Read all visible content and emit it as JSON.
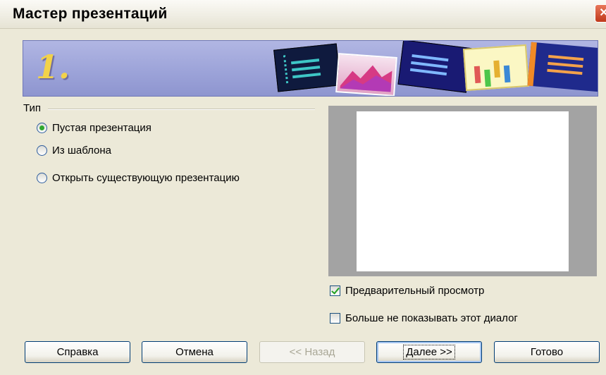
{
  "window": {
    "title": "Мастер презентаций",
    "close_symbol": "✕"
  },
  "banner": {
    "step_number": "1.",
    "slide_thumbnails": [
      "dark-blue-dotted-slide",
      "pink-mountain-chart-slide",
      "navy-bullet-slide",
      "yellow-bar-chart-slide",
      "blue-orange-zigzag-slide"
    ]
  },
  "type_group": {
    "label": "Тип",
    "options": [
      {
        "label": "Пустая презентация",
        "checked": true
      },
      {
        "label": "Из шаблона",
        "checked": false
      },
      {
        "label": "Открыть существующую презентацию",
        "checked": false
      }
    ]
  },
  "preview": {
    "show_preview_label": "Предварительный просмотр",
    "show_preview_checked": true,
    "dont_show_again_label": "Больше не показывать этот диалог",
    "dont_show_again_checked": false
  },
  "buttons": {
    "help": "Справка",
    "cancel": "Отмена",
    "back": "<< Назад",
    "next": "Далее >>",
    "finish": "Готово"
  },
  "colors": {
    "dialog_bg": "#ece9d8",
    "banner_bg": "#9ba2d8",
    "step_number": "#f2d24a",
    "radio_dot": "#2fa82f",
    "preview_frame": "#a3a3a3"
  }
}
